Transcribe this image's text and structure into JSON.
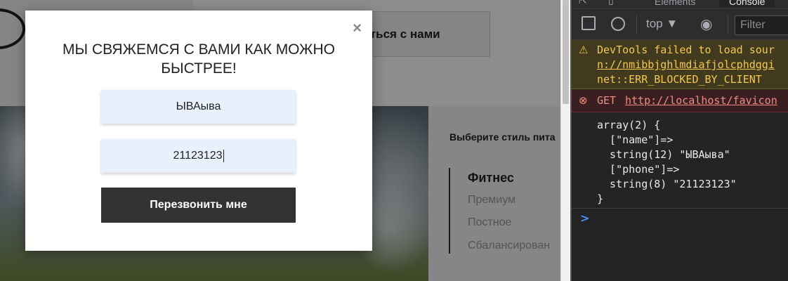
{
  "site": {
    "contact_button": "вязаться с нами",
    "panel": {
      "title": "Выберите стиль пита",
      "active": "Фитнес",
      "items": [
        "Премиум",
        "Постное",
        "Сбалансирован"
      ]
    }
  },
  "modal": {
    "close_icon": "×",
    "title": "МЫ СВЯЖЕМСЯ С ВАМИ КАК МОЖНО БЫСТРЕЕ!",
    "name_value": "ЫВАыва",
    "phone_value": "21123123",
    "submit_label": "Перезвонить мне"
  },
  "devtools": {
    "tabs": {
      "elements": "Elements",
      "console": "Console"
    },
    "toolbar": {
      "context": "top ▼",
      "filter_placeholder": "Filter"
    },
    "warning": {
      "line1": "DevTools failed to load sour",
      "line2": "n://nmibbjghlmdiafjolcphdggi",
      "line3": "net::ERR_BLOCKED_BY_CLIENT"
    },
    "error": {
      "method": "GET",
      "url": "http://localhost/favicon"
    },
    "output": [
      "array(2) {",
      "  [\"name\"]=>",
      "  string(12) \"ЫВАыва\"",
      "  [\"phone\"]=>",
      "  string(8) \"21123123\"",
      "}"
    ],
    "prompt": ">"
  },
  "colors": {
    "button_dark": "#333333",
    "field_bg": "#e8f0fe",
    "warn_text": "#f2c94c",
    "error_text": "#f28b82",
    "prompt": "#4d90fe"
  }
}
